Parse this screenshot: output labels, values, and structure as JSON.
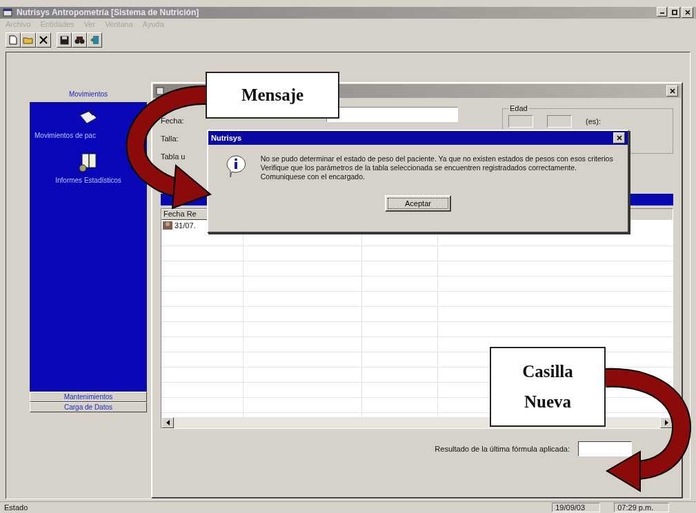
{
  "window": {
    "title": "Nutrisys Antropometría [Sistema de Nutrición]"
  },
  "menu": [
    "Archivo",
    "Entidades",
    "Ver",
    "Ventana",
    "Ayuda"
  ],
  "sidebar": {
    "header": "Movimientos",
    "items": [
      {
        "label": "Movimientos de pac"
      },
      {
        "label": "Informes Estadísticos"
      }
    ],
    "footer": [
      "Mantenimientos",
      "Carga de Datos"
    ]
  },
  "form": {
    "labels": [
      "Fecha:",
      "Talla:",
      "Tabla u"
    ],
    "age_group": {
      "label": "Edad",
      "suffix": "(es):"
    }
  },
  "table": {
    "columns": [
      "Fecha Re"
    ],
    "rows": [
      [
        "31/07."
      ]
    ]
  },
  "result": {
    "label": "Resultado de la última fórmula aplicada:"
  },
  "dialog": {
    "title": "Nutrisys",
    "message": "No se pudo determinar el estado de peso del paciente. Ya que no existen estados de pesos con esos criterios Verifique que los parámetros de la tabla seleccionada se encuentren registradados correctamente.  Comuniquese con el encargado.",
    "button": "Aceptar"
  },
  "callouts": [
    {
      "text": "Mensaje"
    },
    {
      "text": "Casilla Nueva"
    }
  ],
  "status_bar": [
    "Estado",
    "19/09/03",
    "07:29 p.m."
  ]
}
